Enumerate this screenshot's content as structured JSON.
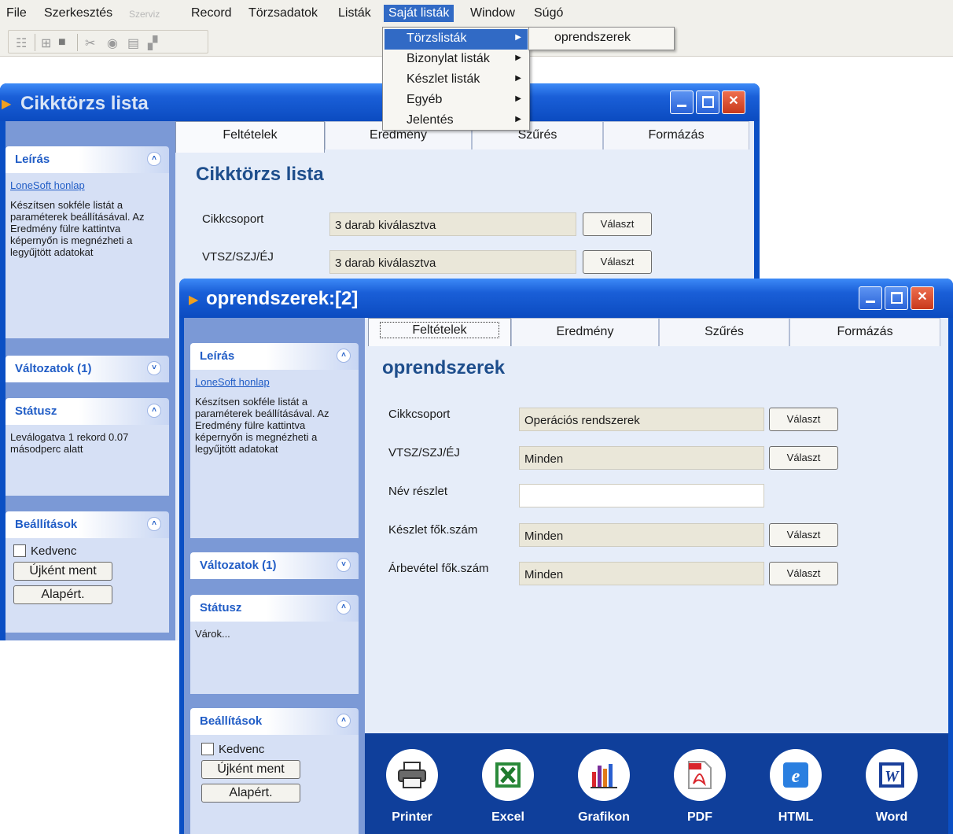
{
  "menubar": {
    "items": [
      "File",
      "Szerkesztés",
      "Szerviz",
      "Record",
      "Törzsadatok",
      "Listák",
      "Saját listák",
      "Window",
      "Súgó"
    ]
  },
  "menu_saja_listak": {
    "items": [
      {
        "label": "Törzslisták"
      },
      {
        "label": "Bizonylat listák"
      },
      {
        "label": "Készlet listák"
      },
      {
        "label": "Egyéb"
      },
      {
        "label": "Jelentés"
      }
    ],
    "submenu_item": "oprendszerek"
  },
  "win1": {
    "title": "Cikktörzs lista",
    "tabs": [
      "Feltételek",
      "Eredmény",
      "Szűrés",
      "Formázás"
    ],
    "heading": "Cikktörzs lista",
    "fields": [
      {
        "label": "Cikkcsoport",
        "value": "3 darab kiválasztva",
        "button": "Választ"
      },
      {
        "label": "VTSZ/SZJ/ÉJ",
        "value": "3 darab kiválasztva",
        "button": "Választ"
      }
    ],
    "side": {
      "leiras_title": "Leírás",
      "link": "LoneSoft honlap",
      "leiras_text": "Készítsen sokféle listát a paraméterek beállításával. Az Eredmény fülre kattintva képernyőn is megnézheti a legyűjtött adatokat",
      "valtozatok_title": "Változatok (1)",
      "statusz_title": "Státusz",
      "statusz_text": "Leválogatva 1 rekord 0.07 másodperc alatt",
      "beallitasok_title": "Beállítások",
      "kedvenc": "Kedvenc",
      "ujkent": "Újként ment",
      "alapert": "Alapért."
    }
  },
  "win2": {
    "title": "oprendszerek:[2]",
    "tabs": [
      "Feltételek",
      "Eredmény",
      "Szűrés",
      "Formázás"
    ],
    "heading": "oprendszerek",
    "fields": [
      {
        "label": "Cikkcsoport",
        "value": "Operációs rendszerek",
        "button": "Választ"
      },
      {
        "label": "VTSZ/SZJ/ÉJ",
        "value": "Minden",
        "button": "Választ"
      },
      {
        "label": "Név részlet",
        "value": "",
        "button": ""
      },
      {
        "label": "Készlet fők.szám",
        "value": "Minden",
        "button": "Választ"
      },
      {
        "label": "Árbevétel fők.szám",
        "value": "Minden",
        "button": "Választ"
      }
    ],
    "side": {
      "leiras_title": "Leírás",
      "link": "LoneSoft honlap",
      "leiras_text": "Készítsen sokféle listát a paraméterek beállításával. Az Eredmény fülre kattintva képernyőn is megnézheti a legyűjtött adatokat",
      "valtozatok_title": "Változatok (1)",
      "statusz_title": "Státusz",
      "statusz_text": "Várok...",
      "beallitasok_title": "Beállítások",
      "kedvenc": "Kedvenc",
      "ujkent": "Újként ment",
      "alapert": "Alapért."
    },
    "exports": [
      {
        "label": "Printer",
        "icon": "printer-icon"
      },
      {
        "label": "Excel",
        "icon": "excel-icon"
      },
      {
        "label": "Grafikon",
        "icon": "chart-icon"
      },
      {
        "label": "PDF",
        "icon": "pdf-icon"
      },
      {
        "label": "HTML",
        "icon": "html-icon"
      },
      {
        "label": "Word",
        "icon": "word-icon"
      }
    ]
  },
  "colors": {
    "xp_blue": "#0a4fc4",
    "menu_highlight": "#316ac5",
    "heading": "#1e4e8c",
    "export_bar": "#0f3f9b"
  }
}
